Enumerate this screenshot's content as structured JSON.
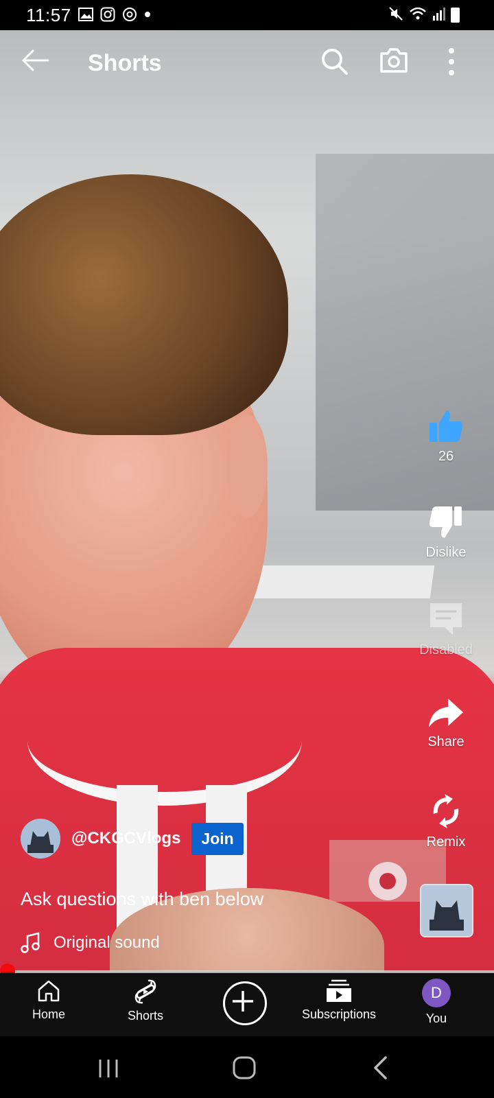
{
  "status_bar": {
    "time": "11:57",
    "icons": [
      "image-icon",
      "instagram-icon",
      "threads-icon",
      "dot-icon",
      "mute-icon",
      "wifi-icon",
      "signal-icon",
      "battery-icon"
    ]
  },
  "header": {
    "title": "Shorts"
  },
  "actions": {
    "like_count": "26",
    "dislike_label": "Dislike",
    "comments_label": "Disabled",
    "share_label": "Share",
    "remix_label": "Remix"
  },
  "video_info": {
    "channel_handle": "@CKGCVlogs",
    "join_label": "Join",
    "description": "Ask questions with ben below",
    "sound_label": "Original sound"
  },
  "nav": {
    "home": "Home",
    "shorts": "Shorts",
    "subscriptions": "Subscriptions",
    "you": "You",
    "you_initial": "D"
  },
  "colors": {
    "accent_like": "#3ea6ff",
    "join_button": "#0b63ce",
    "progress": "#ff0000",
    "you_avatar": "#7e57c2"
  }
}
